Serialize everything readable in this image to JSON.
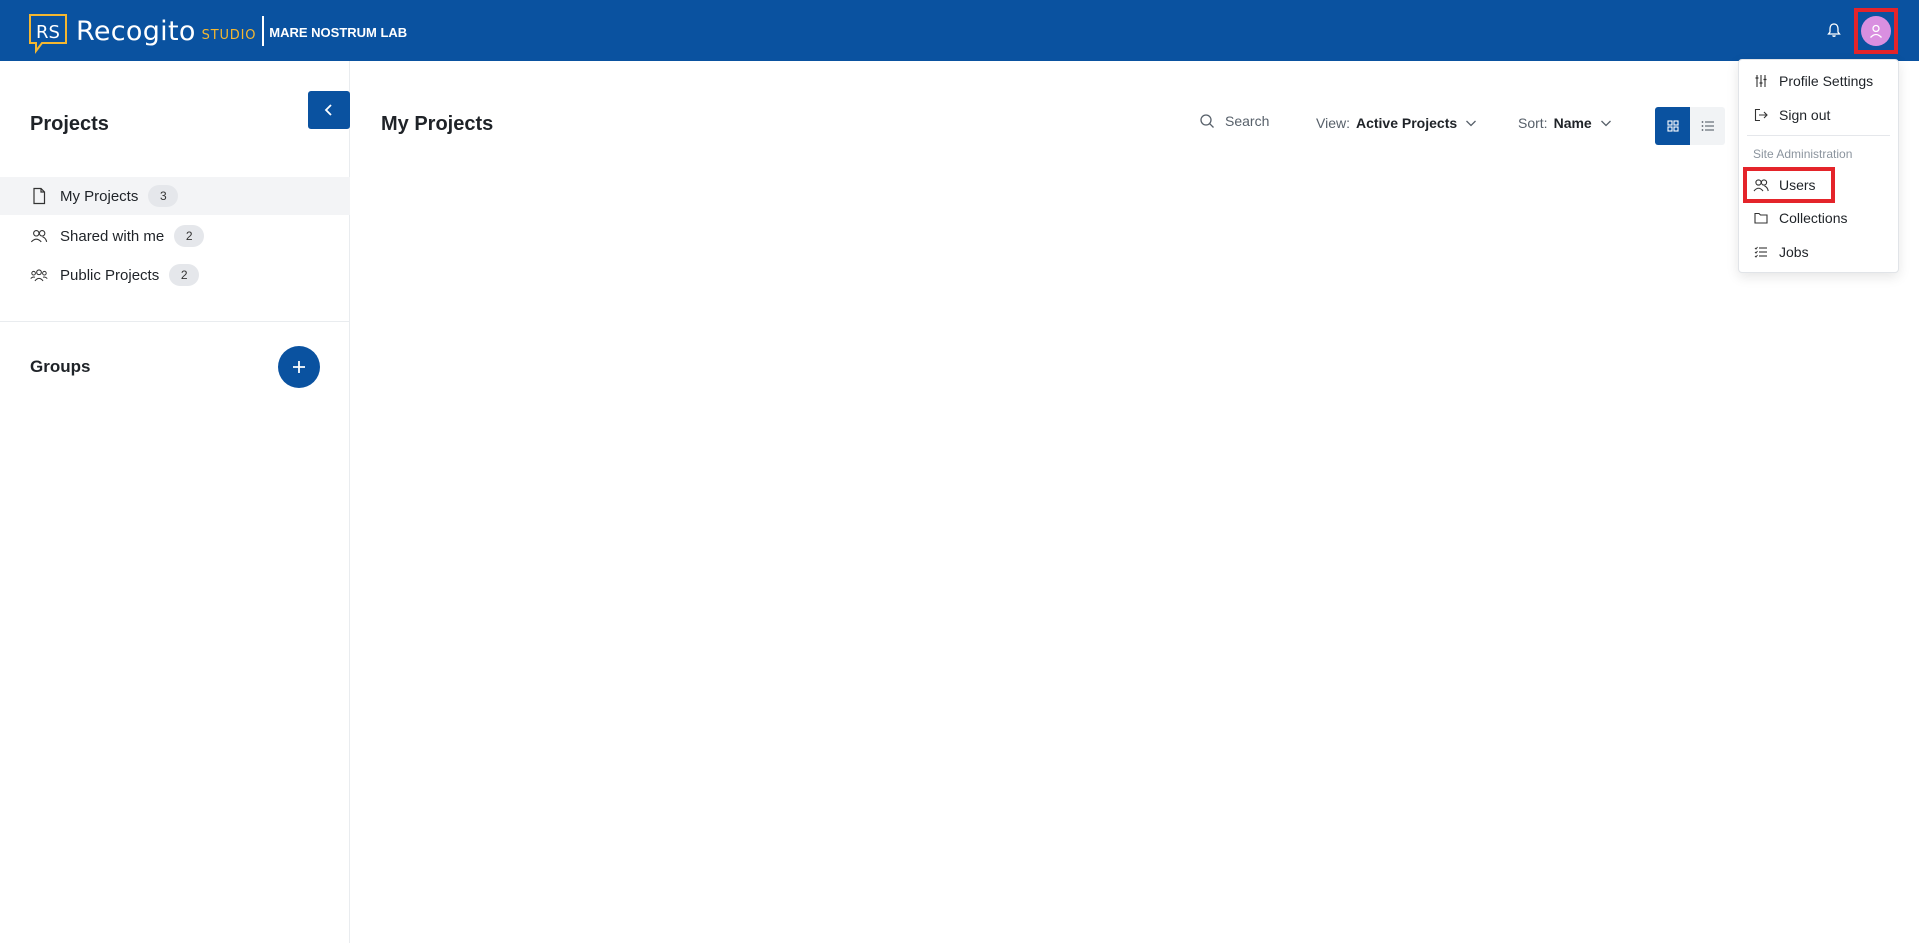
{
  "brand": {
    "logo_mark": "RS",
    "name": "Recogito",
    "studio": "STUDIO",
    "lab": "MARE NOSTRUM LAB"
  },
  "icons": {
    "bell": "bell-icon",
    "avatar": "user-icon"
  },
  "sidebar": {
    "title": "Projects",
    "items": [
      {
        "label": "My Projects",
        "count": "3",
        "icon": "document-icon"
      },
      {
        "label": "Shared with me",
        "count": "2",
        "icon": "users-icon"
      },
      {
        "label": "Public Projects",
        "count": "2",
        "icon": "group-icon"
      }
    ],
    "groups_title": "Groups"
  },
  "main": {
    "title": "My Projects",
    "search_label": "Search",
    "view_label": "View:",
    "view_value": "Active Projects",
    "sort_label": "Sort:",
    "sort_value": "Name"
  },
  "menu": {
    "items": [
      {
        "label": "Profile Settings",
        "icon": "sliders-icon"
      },
      {
        "label": "Sign out",
        "icon": "sign-out-icon"
      }
    ],
    "section_label": "Site Administration",
    "admin_items": [
      {
        "label": "Users",
        "icon": "users-icon"
      },
      {
        "label": "Collections",
        "icon": "folder-icon"
      },
      {
        "label": "Jobs",
        "icon": "list-check-icon"
      }
    ]
  },
  "colors": {
    "primary": "#0a52a0",
    "accent": "#f4b731",
    "highlight": "#e4242a",
    "avatar": "#d98fe0"
  }
}
